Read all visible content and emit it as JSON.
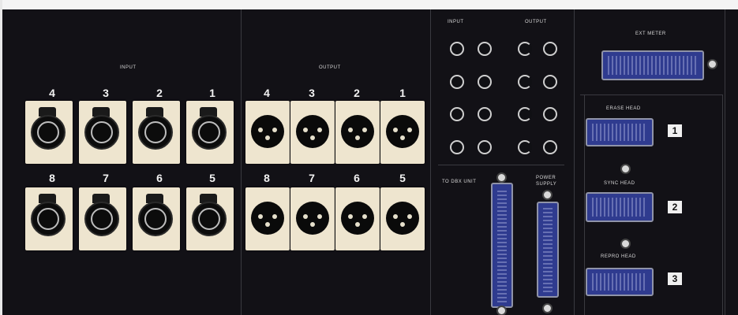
{
  "left_input": {
    "title": "INPUT",
    "top_numbers": [
      "4",
      "3",
      "2",
      "1"
    ],
    "bottom_numbers": [
      "8",
      "7",
      "6",
      "5"
    ]
  },
  "left_output": {
    "title": "OUTPUT",
    "top_numbers": [
      "4",
      "3",
      "2",
      "1"
    ],
    "bottom_numbers": [
      "8",
      "7",
      "6",
      "5"
    ]
  },
  "rca_section": {
    "input_title": "INPUT",
    "output_title": "OUTPUT"
  },
  "connectors": {
    "ext_meter": "EXT METER",
    "to_dbx_unit": "TO DBX UNIT",
    "power_supply": "POWER SUPPLY",
    "erase_head": "ERASE HEAD",
    "sync_head": "SYNC HEAD",
    "repro_head": "REPRO HEAD"
  },
  "head_numbers": [
    "1",
    "2",
    "3"
  ],
  "colors": {
    "panel": "#121116",
    "plate": "#eee5cf",
    "dsub": "#2f3b8f"
  }
}
